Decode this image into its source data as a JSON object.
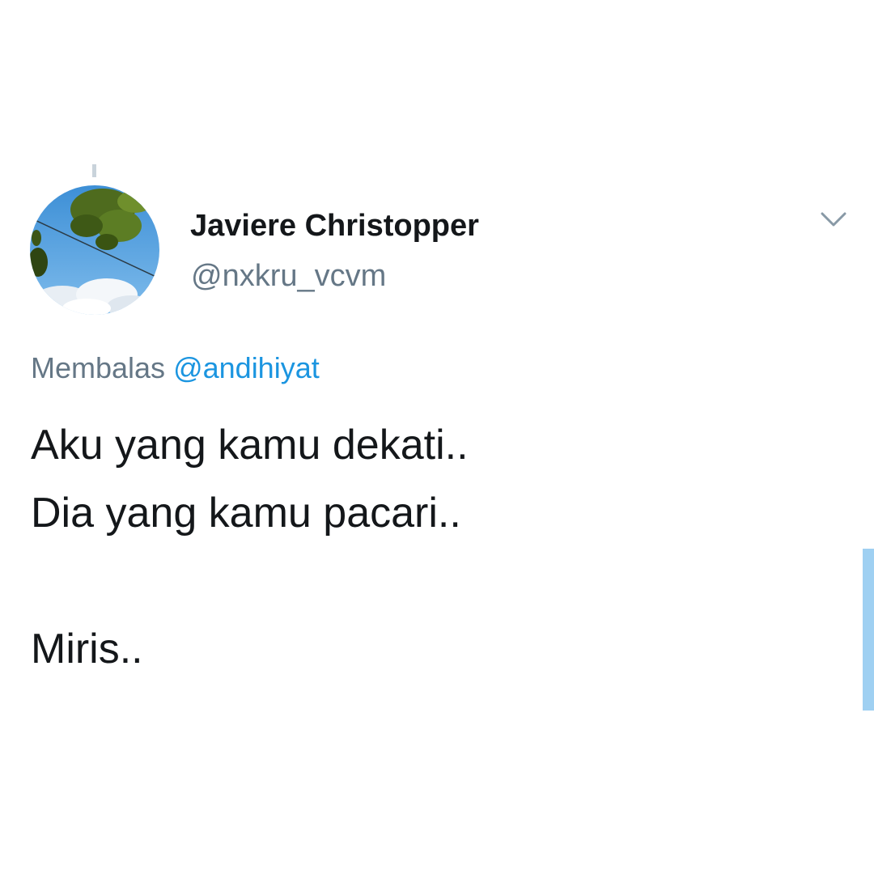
{
  "tweet": {
    "author": {
      "display_name": "Javiere Christopper",
      "handle": "@nxkru_vcvm",
      "avatar": "sky-and-leaves-avatar"
    },
    "reply_prefix": "Membalas",
    "reply_to": "@andihiyat",
    "text_lines": [
      "Aku yang kamu dekati..",
      "Dia yang kamu pacari..",
      "Miris.."
    ]
  },
  "icons": {
    "menu": "chevron-down-icon"
  },
  "colors": {
    "text_primary": "#14171a",
    "text_secondary": "#657786",
    "link": "#1b95e0",
    "scroll_thumb": "#9fd0f2"
  }
}
